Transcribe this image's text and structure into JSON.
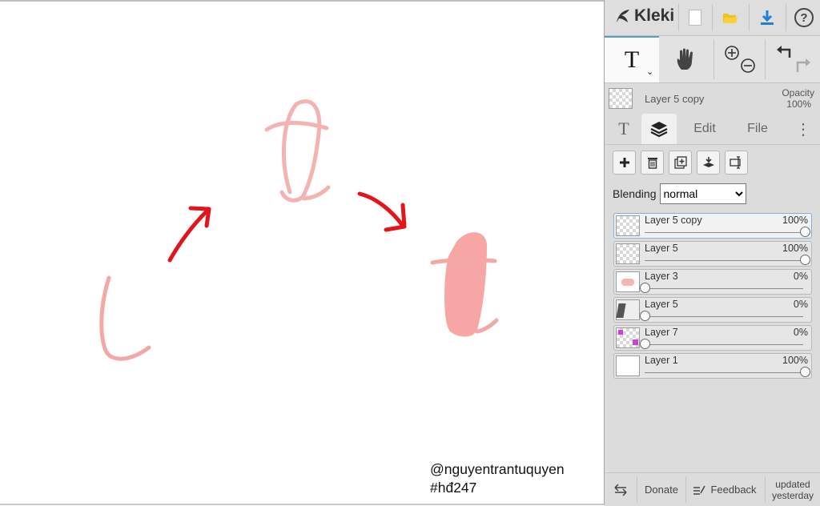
{
  "app": {
    "name": "Kleki"
  },
  "canvas": {
    "watermark_line1": "@nguyentrantuquyen",
    "watermark_line2": "#hđ247",
    "colors": {
      "pink": "#f4a8a6",
      "red_arrow": "#e4141b"
    }
  },
  "toolbar": {
    "icons": [
      "new-image-icon",
      "open-file-icon",
      "download-icon",
      "help-icon"
    ],
    "tools": [
      "text-tool",
      "hand-tool",
      "zoom-in-icon",
      "zoom-out-icon",
      "undo-icon",
      "redo-icon"
    ],
    "text_tool_glyph": "T",
    "help_glyph": "?"
  },
  "current_layer": {
    "name": "Layer 5 copy",
    "opacity_label": "Opacity",
    "opacity_value": "100%"
  },
  "tabs": [
    {
      "label": "T",
      "icon": "text-tab"
    },
    {
      "label": "",
      "icon": "layers-icon",
      "active": true
    },
    {
      "label": "Edit"
    },
    {
      "label": "File"
    },
    {
      "label": "⋮"
    }
  ],
  "layer_actions": [
    "add-layer-icon",
    "delete-layer-icon",
    "duplicate-layer-icon",
    "merge-down-icon",
    "rename-layer-icon"
  ],
  "blending": {
    "label": "Blending",
    "value": "normal",
    "options": [
      "normal"
    ]
  },
  "layers": [
    {
      "name": "Layer 5 copy",
      "opacity": "100%",
      "opacity_fraction": 1.0,
      "selected": true,
      "thumb": "transparent"
    },
    {
      "name": "Layer 5",
      "opacity": "100%",
      "opacity_fraction": 1.0,
      "selected": false,
      "thumb": "transparent"
    },
    {
      "name": "Layer 3",
      "opacity": "0%",
      "opacity_fraction": 0.0,
      "selected": false,
      "thumb": "pink-sketch"
    },
    {
      "name": "Layer 5",
      "opacity": "0%",
      "opacity_fraction": 0.0,
      "selected": false,
      "thumb": "dark-sketch"
    },
    {
      "name": "Layer 7",
      "opacity": "0%",
      "opacity_fraction": 0.0,
      "selected": false,
      "thumb": "purple-sketch"
    },
    {
      "name": "Layer 1",
      "opacity": "100%",
      "opacity_fraction": 1.0,
      "selected": false,
      "thumb": "white"
    }
  ],
  "bottom": {
    "donate": "Donate",
    "feedback": "Feedback",
    "updated_line1": "updated",
    "updated_line2": "yesterday"
  }
}
